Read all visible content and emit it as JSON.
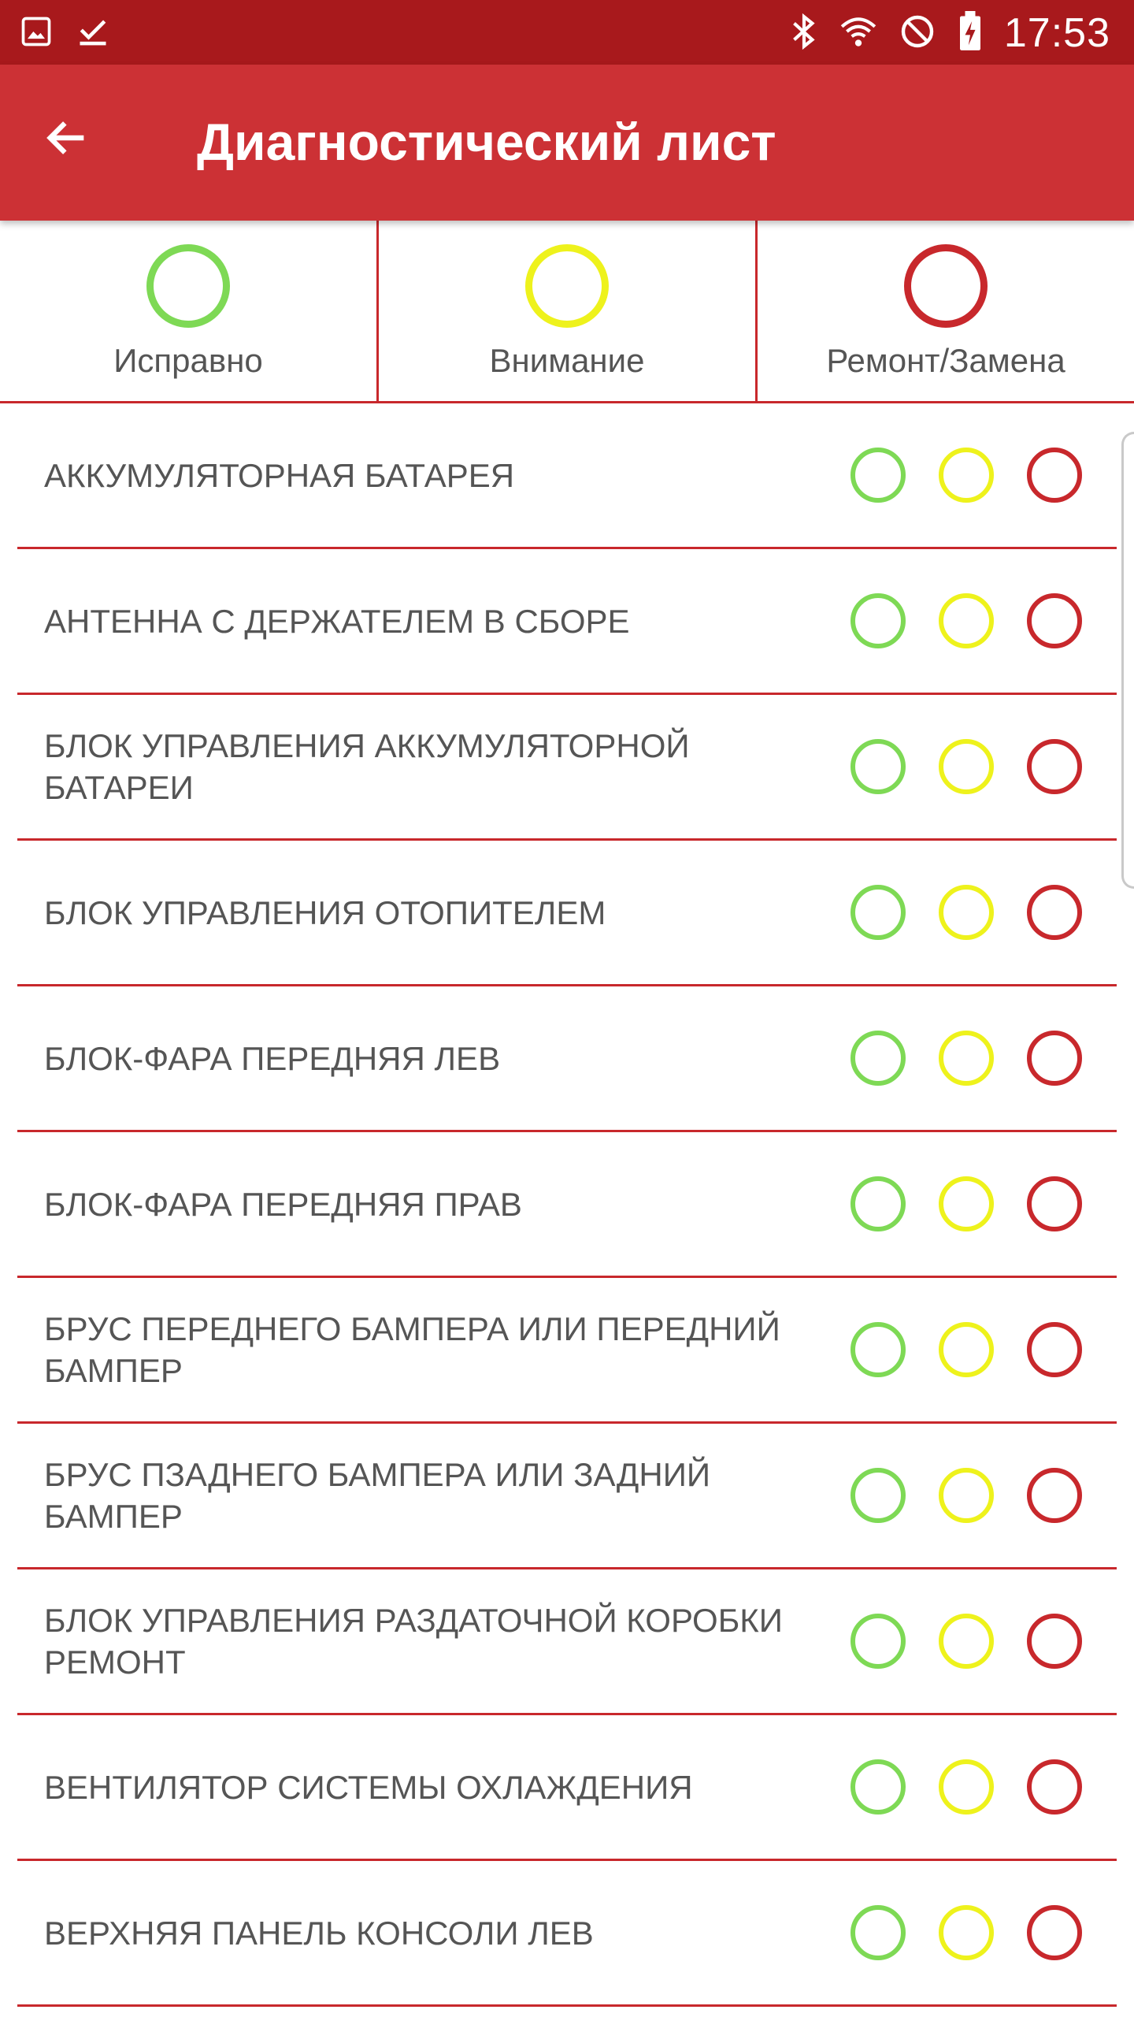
{
  "status_bar": {
    "time": "17:53",
    "left_icons": [
      "image-icon",
      "check-icon"
    ],
    "right_icons": [
      "bluetooth-icon",
      "wifi-icon",
      "do-not-disturb-icon",
      "battery-charging-icon"
    ]
  },
  "app_bar": {
    "title": "Диагностический лист",
    "back_icon": "arrow-back-icon"
  },
  "legend": {
    "good": "Исправно",
    "attention": "Внимание",
    "repair": "Ремонт/Замена"
  },
  "colors": {
    "good": "#7ed955",
    "attention": "#eef21c",
    "repair": "#c8282c",
    "status_bar": "#a8191c",
    "app_bar": "#cc3135"
  },
  "items": [
    "АККУМУЛЯТОРНАЯ БАТАРЕЯ",
    "АНТЕННА С ДЕРЖАТЕЛЕМ В СБОРЕ",
    "БЛОК УПРАВЛЕНИЯ АККУМУЛЯТОРНОЙ БАТАРЕИ",
    "БЛОК УПРАВЛЕНИЯ ОТОПИТЕЛЕМ",
    "БЛОК-ФАРА ПЕРЕДНЯЯ ЛЕВ",
    "БЛОК-ФАРА ПЕРЕДНЯЯ ПРАВ",
    "БРУС ПЕРЕДНЕГО БАМПЕРА ИЛИ ПЕРЕДНИЙ БАМПЕР",
    "БРУС ПЗАДНЕГО БАМПЕРА ИЛИ ЗАДНИЙ БАМПЕР",
    "БЛОК УПРАВЛЕНИЯ РАЗДАТОЧНОЙ КОРОБКИ РЕМОНТ",
    "ВЕНТИЛЯТОР СИСТЕМЫ ОХЛАЖДЕНИЯ",
    "ВЕРХНЯЯ ПАНЕЛЬ КОНСОЛИ ЛЕВ"
  ]
}
